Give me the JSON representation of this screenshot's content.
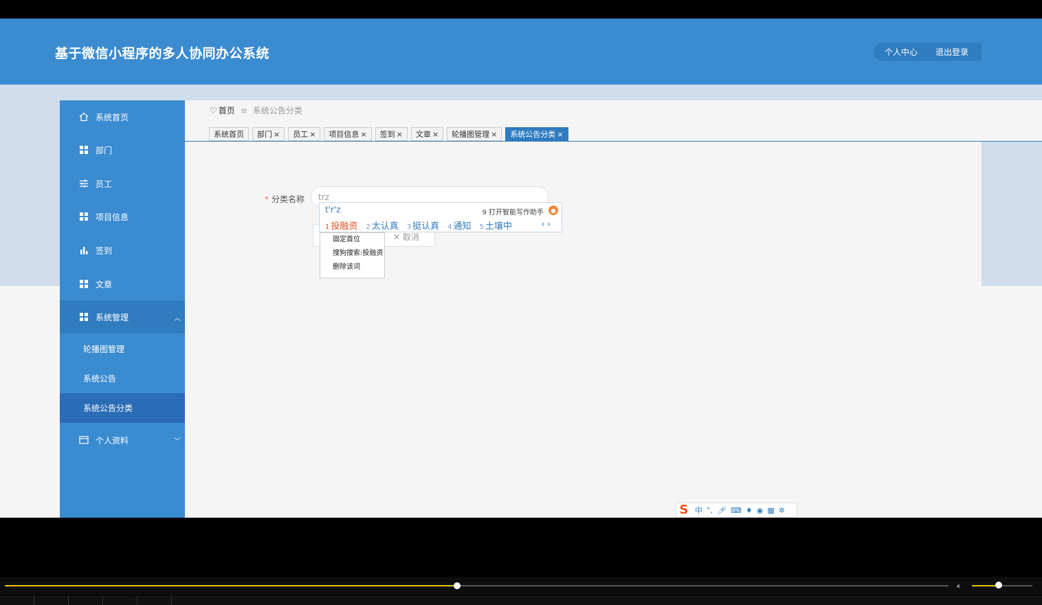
{
  "header": {
    "title": "基于微信小程序的多人协同办公系统",
    "profile_label": "个人中心",
    "logout_label": "退出登录"
  },
  "sidebar": {
    "items": [
      {
        "label": "系统首页",
        "icon": "home-icon"
      },
      {
        "label": "部门",
        "icon": "grid-icon"
      },
      {
        "label": "员工",
        "icon": "sliders-icon"
      },
      {
        "label": "项目信息",
        "icon": "grid-icon"
      },
      {
        "label": "签到",
        "icon": "bar-chart-icon"
      },
      {
        "label": "文章",
        "icon": "grid-icon"
      },
      {
        "label": "系统管理",
        "icon": "grid-icon",
        "expanded": true
      },
      {
        "label": "个人资料",
        "icon": "card-icon",
        "expanded": false
      }
    ],
    "submenu": [
      "轮播图管理",
      "系统公告",
      "系统公告分类"
    ],
    "active_sub": "系统公告分类"
  },
  "breadcrumb": {
    "home": "首页",
    "separator": "≡",
    "current": "系统公告分类"
  },
  "tabs": [
    {
      "label": "系统首页",
      "closable": false
    },
    {
      "label": "部门",
      "closable": true
    },
    {
      "label": "员工",
      "closable": true
    },
    {
      "label": "项目信息",
      "closable": true
    },
    {
      "label": "签到",
      "closable": true
    },
    {
      "label": "文章",
      "closable": true
    },
    {
      "label": "轮播图管理",
      "closable": true
    },
    {
      "label": "系统公告分类",
      "closable": true,
      "active": true
    }
  ],
  "tab_close": "×",
  "form": {
    "required_mark": "*",
    "label": "分类名称",
    "value": "trz",
    "cancel_label": "取消",
    "cancel_icon": "✕"
  },
  "ime": {
    "composing": "t'r'z",
    "assistant": "9 打开智能写作助手",
    "candidates": [
      {
        "num": "1",
        "text": "投融资"
      },
      {
        "num": "2",
        "text": "太认真"
      },
      {
        "num": "3",
        "text": "挺认真"
      },
      {
        "num": "4",
        "text": "通知"
      },
      {
        "num": "5",
        "text": "土壤中"
      }
    ],
    "nav": "‹ ›"
  },
  "context_menu": [
    "固定首位",
    "搜狗搜索:投融资",
    "删除该词"
  ],
  "ime_toolbar": {
    "logo": "S",
    "mode": "中"
  },
  "player": {
    "progress": 0.479,
    "volume": 0.44
  },
  "colors": {
    "header_bg": "#3a8bd0",
    "sidebar_bg": "#3a8bd0",
    "active_bg": "#2f7cbf",
    "progress": "#e8c200"
  }
}
